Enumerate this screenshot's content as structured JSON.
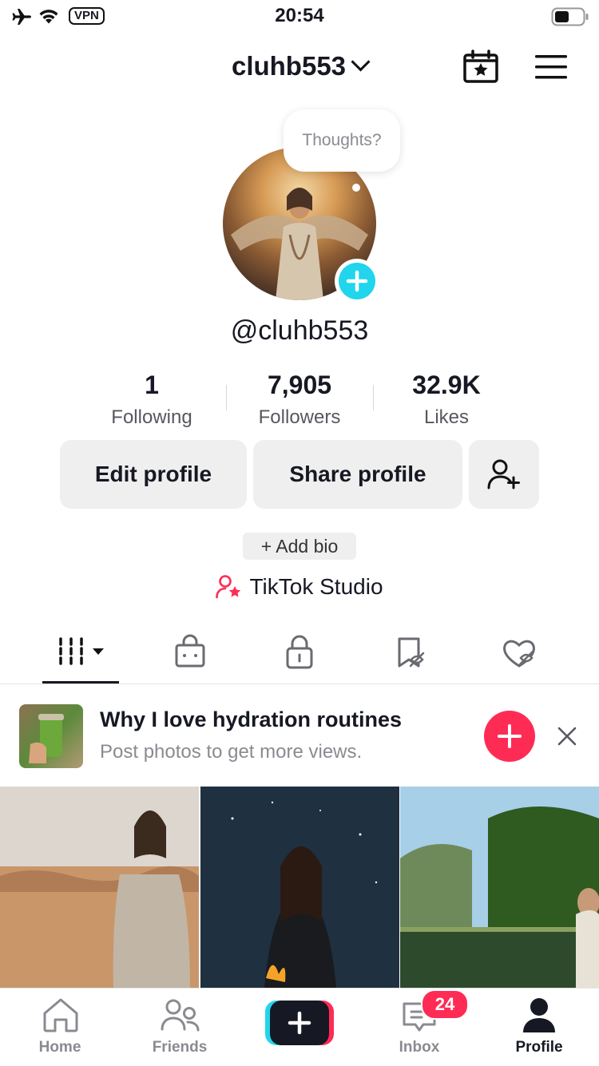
{
  "status_bar": {
    "time": "20:54",
    "vpn_label": "VPN"
  },
  "header": {
    "username": "cluhb553"
  },
  "avatar": {
    "thought_bubble": "Thoughts?"
  },
  "profile": {
    "handle": "@cluhb553",
    "stats": [
      {
        "value": "1",
        "label": "Following"
      },
      {
        "value": "7,905",
        "label": "Followers"
      },
      {
        "value": "32.9K",
        "label": "Likes"
      }
    ],
    "edit_profile_label": "Edit profile",
    "share_profile_label": "Share profile",
    "add_bio_label": "+ Add bio",
    "studio_label": "TikTok Studio"
  },
  "promo": {
    "title": "Why I love hydration routines",
    "subtitle": "Post photos to get more views."
  },
  "bottom_nav": {
    "home": "Home",
    "friends": "Friends",
    "inbox": "Inbox",
    "inbox_badge": "24",
    "profile": "Profile"
  },
  "colors": {
    "accent_red": "#fe2c55",
    "accent_cyan": "#20d5ec",
    "text": "#161823",
    "muted": "#8a8b91"
  }
}
